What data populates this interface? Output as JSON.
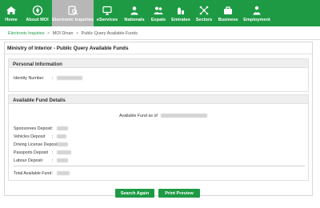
{
  "nav": {
    "items": [
      {
        "label": "Home",
        "icon": "home-icon",
        "active": false
      },
      {
        "label": "About MOI",
        "icon": "moi-emblem-icon",
        "active": false
      },
      {
        "label": "Electronic Inquiries",
        "icon": "electronic-inquiries-icon",
        "active": true
      },
      {
        "label": "eServices",
        "icon": "eservices-icon",
        "active": false
      },
      {
        "label": "Nationals",
        "icon": "nationals-icon",
        "active": false
      },
      {
        "label": "Expats",
        "icon": "expats-icon",
        "active": false
      },
      {
        "label": "Emirates",
        "icon": "emirates-icon",
        "active": false
      },
      {
        "label": "Sectors",
        "icon": "sectors-icon",
        "active": false
      },
      {
        "label": "Business",
        "icon": "business-icon",
        "active": false
      },
      {
        "label": "Employment",
        "icon": "employment-icon",
        "active": false
      }
    ],
    "bg_color": "#1e9a44",
    "active_color": "#b7b7b7"
  },
  "breadcrumb": {
    "items": [
      "Electronic Inquiries",
      "MOI Dinan",
      "Public Query Available Funds"
    ],
    "separator": ">"
  },
  "page": {
    "title": "Ministry of Interior - Public Query Available Funds"
  },
  "personal": {
    "heading": "Personal Information",
    "identity_label": "Identity Number",
    "colon": ":"
  },
  "funds": {
    "heading": "Available Fund Details",
    "available_as_of_label": "Available Fund as of",
    "rows": [
      {
        "label": "Sponsorees Deposit"
      },
      {
        "label": "Vehicles Deposit"
      },
      {
        "label": "Driving License Deposit"
      },
      {
        "label": "Passports Deposit"
      },
      {
        "label": "Labour Deposit"
      }
    ],
    "total_label": "Total Available Fund"
  },
  "buttons": {
    "search_again": "Search Again",
    "print_preview": "Print Preview"
  }
}
